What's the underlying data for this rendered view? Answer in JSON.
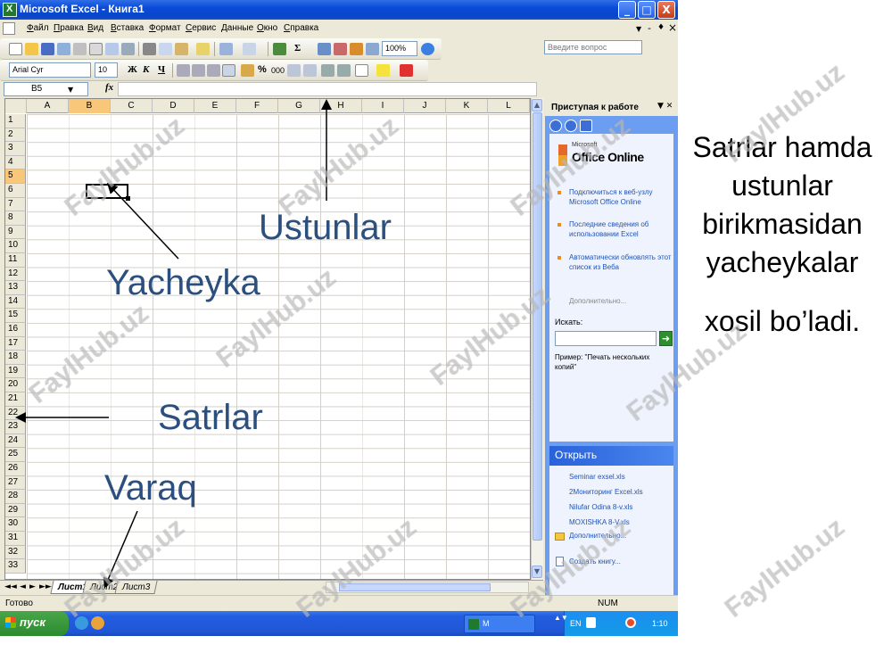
{
  "window": {
    "title": "Microsoft Excel - Книга1",
    "controls": {
      "minimize": "_",
      "maximize": "□",
      "close": "X"
    }
  },
  "menu": {
    "items": [
      "Файл",
      "Правка",
      "Вид",
      "Вставка",
      "Формат",
      "Сервис",
      "Данные",
      "Окно",
      "Справка"
    ],
    "help_placeholder": "Введите вопрос",
    "doc_controls": {
      "minimize": "-",
      "restore": "♦",
      "close": "×"
    }
  },
  "toolbar_standard": {
    "zoom": "100%",
    "sum": "Σ"
  },
  "toolbar_format": {
    "font": "Arial Cyr",
    "size": "10",
    "bold": "Ж",
    "italic": "К",
    "underline": "Ч",
    "percent": "%",
    "thousands": "000"
  },
  "formula_bar": {
    "name_box": "B5",
    "fx": "fx",
    "value": ""
  },
  "grid": {
    "columns": [
      "A",
      "B",
      "C",
      "D",
      "E",
      "F",
      "G",
      "H",
      "I",
      "J",
      "K",
      "L"
    ],
    "rows": [
      "1",
      "2",
      "3",
      "4",
      "5",
      "6",
      "7",
      "8",
      "9",
      "10",
      "11",
      "12",
      "13",
      "14",
      "15",
      "16",
      "17",
      "18",
      "19",
      "20",
      "21",
      "22",
      "23",
      "24",
      "25",
      "26",
      "27",
      "28",
      "29",
      "30",
      "31",
      "32",
      "33"
    ],
    "selected_column": "B",
    "selected_row": "5"
  },
  "sheet_tabs": {
    "nav": [
      "◄◄",
      "◄",
      "►",
      "►►"
    ],
    "tabs": [
      "Лист1",
      "Лист2",
      "Лист3"
    ],
    "active": "Лист1"
  },
  "status_bar": {
    "status": "Готово",
    "num": "NUM"
  },
  "task_pane": {
    "title": "Приступая к работе",
    "office_online": {
      "microsoft": "Microsoft",
      "name": "Office Online"
    },
    "links": [
      "Подключиться к веб-узлу Microsoft Office Online",
      "Последние сведения об использовании Excel",
      "Автоматически обновлять этот список из Веба"
    ],
    "more": "Дополнительно...",
    "search_label": "Искать:",
    "search_value": "",
    "example": "Пример:  \"Печать нескольких копий\"",
    "open_section": {
      "title": "Открыть",
      "files": [
        "Seminar exsel.xls",
        "2Мониторинг Excel.xls",
        "Nilufar Odina 8-v.xls",
        "MOXISHKA  8-V.xls"
      ],
      "more": "Дополнительно...",
      "create": "Создать книгу..."
    }
  },
  "taskbar": {
    "start": "пуск",
    "task_button": "M",
    "tray_lang": "EN",
    "clock": "1:10"
  },
  "annotations": {
    "ustunlar": "Ustunlar",
    "yacheyka": "Yacheyka",
    "satrlar": "Satrlar",
    "varaq": "Varaq",
    "note_lines": [
      "Satrlar hamda",
      "ustunlar",
      "birikmasidan",
      "yacheykalar",
      "xosil bo’ladi."
    ]
  },
  "watermark": "FaylHub.uz",
  "colors": {
    "title_bar": "#0a4ad8",
    "selection_header": "#f9c77a",
    "task_pane": "#6b9df0",
    "annotation_text": "#2b4f7e",
    "start_button": "#2d8a2d"
  }
}
